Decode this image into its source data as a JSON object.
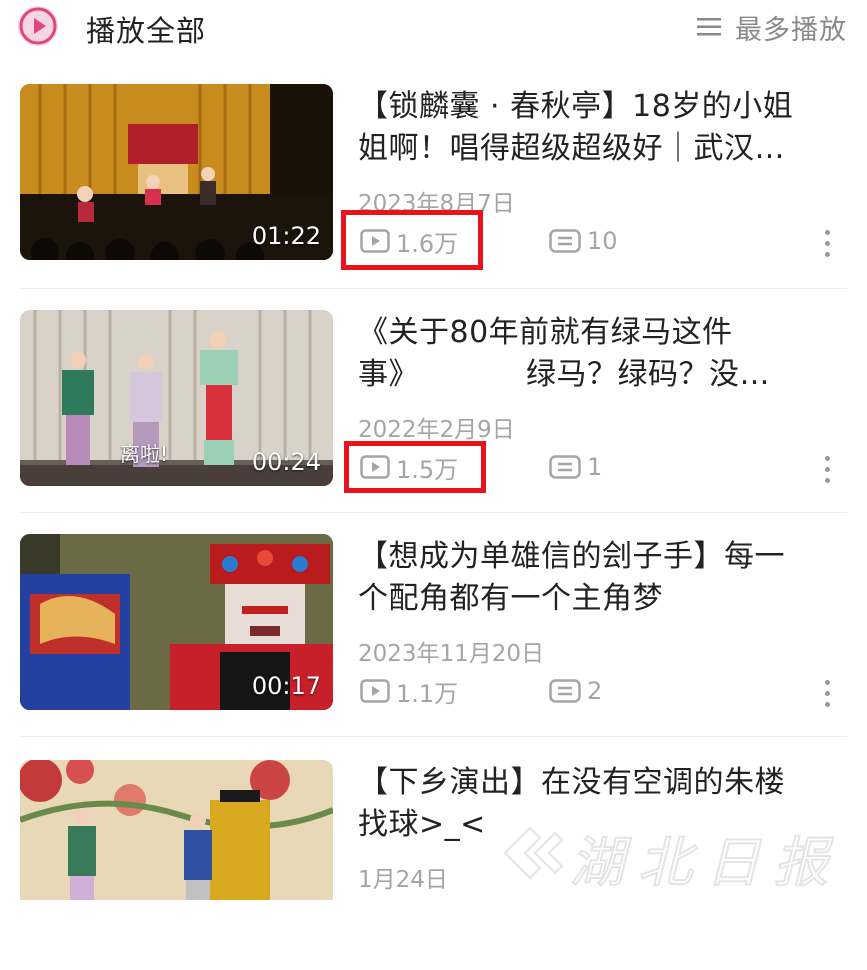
{
  "header": {
    "play_all_label": "播放全部",
    "sort_label": "最多播放",
    "accent_color": "#e0457b"
  },
  "videos": [
    {
      "title_line1": "【锁麟囊 · 春秋亭】18岁的小姐",
      "title_line2": "姐啊！唱得超级超级好｜武汉…",
      "date": "2023年8月7日",
      "duration": "01:22",
      "views": "1.6万",
      "comments": "10",
      "views_highlighted": true,
      "thumb_caption": ""
    },
    {
      "title_line1": "《关于80年前就有绿马这件",
      "title_line2": "事》　　　　绿马？绿码？没…",
      "date": "2022年2月9日",
      "duration": "00:24",
      "views": "1.5万",
      "comments": "1",
      "views_highlighted": true,
      "thumb_caption": "离啦!"
    },
    {
      "title_line1": "【想成为单雄信的刽子手】每一",
      "title_line2": "个配角都有一个主角梦",
      "date": "2023年11月20日",
      "duration": "00:17",
      "views": "1.1万",
      "comments": "2",
      "views_highlighted": false,
      "thumb_caption": ""
    },
    {
      "title_line1": "【下乡演出】在没有空调的朱楼",
      "title_line2": "找球>_<",
      "date": "1月24日",
      "duration": "",
      "views": "",
      "comments": "",
      "views_highlighted": false,
      "thumb_caption": ""
    }
  ],
  "icons": {
    "play_all": "play-circle-icon",
    "sort": "list-sort-icon",
    "views": "play-count-icon",
    "comments": "comment-icon",
    "more": "more-vertical-icon"
  },
  "watermark": "湖北日报",
  "highlight_color": "#e8131d"
}
